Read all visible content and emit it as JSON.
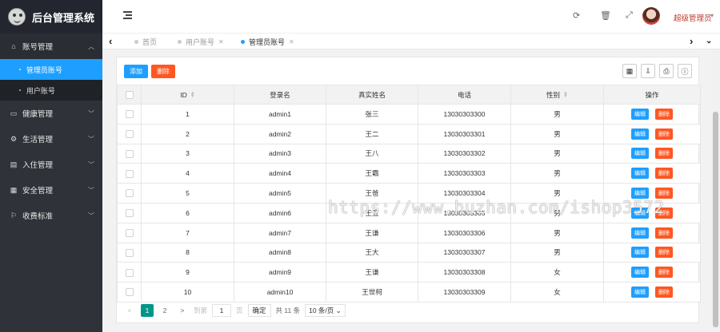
{
  "app": {
    "title": "后台管理系统"
  },
  "sidebar": {
    "groups": [
      {
        "label": "账号管理",
        "icon": "home-icon",
        "open": true,
        "children": [
          {
            "label": "管理员账号",
            "icon": "dashboard-icon",
            "active": true
          },
          {
            "label": "用户账号",
            "icon": "dashboard-icon",
            "active": false
          }
        ]
      },
      {
        "label": "健康管理",
        "icon": "card-icon"
      },
      {
        "label": "生活管理",
        "icon": "cog-icon"
      },
      {
        "label": "入住管理",
        "icon": "file-icon"
      },
      {
        "label": "安全管理",
        "icon": "calendar-icon"
      },
      {
        "label": "收费标准",
        "icon": "flag-icon"
      }
    ]
  },
  "header": {
    "user_name": "超级管理员",
    "icons": [
      "refresh-icon",
      "trash-icon",
      "fullscreen-icon"
    ]
  },
  "tabs": {
    "items": [
      {
        "label": "首页",
        "closable": false,
        "active": false
      },
      {
        "label": "用户账号",
        "closable": true,
        "active": false
      },
      {
        "label": "管理员账号",
        "closable": true,
        "active": true
      }
    ]
  },
  "toolbar": {
    "add_label": "添加",
    "delete_label": "删除"
  },
  "table": {
    "headers": {
      "id": "ID",
      "login": "登录名",
      "realname": "真实姓名",
      "phone": "电话",
      "gender": "性别",
      "actions": "操作"
    },
    "edit_label": "编辑",
    "delete_label": "删除",
    "rows": [
      {
        "id": "1",
        "login": "admin1",
        "realname": "张三",
        "phone": "13030303300",
        "gender": "男"
      },
      {
        "id": "2",
        "login": "admin2",
        "realname": "王二",
        "phone": "13030303301",
        "gender": "男"
      },
      {
        "id": "3",
        "login": "admin3",
        "realname": "王八",
        "phone": "13030303302",
        "gender": "男"
      },
      {
        "id": "4",
        "login": "admin4",
        "realname": "王霸",
        "phone": "13030303303",
        "gender": "男"
      },
      {
        "id": "5",
        "login": "admin5",
        "realname": "王爸",
        "phone": "13030303304",
        "gender": "男"
      },
      {
        "id": "6",
        "login": "admin6",
        "realname": "王五",
        "phone": "13030303305",
        "gender": "男"
      },
      {
        "id": "7",
        "login": "admin7",
        "realname": "王谦",
        "phone": "13030303306",
        "gender": "男"
      },
      {
        "id": "8",
        "login": "admin8",
        "realname": "王大",
        "phone": "13030303307",
        "gender": "男"
      },
      {
        "id": "9",
        "login": "admin9",
        "realname": "王谦",
        "phone": "13030303308",
        "gender": "女"
      },
      {
        "id": "10",
        "login": "admin10",
        "realname": "王世柯",
        "phone": "13030303309",
        "gender": "女"
      }
    ]
  },
  "pager": {
    "prev": "<",
    "pages": [
      "1",
      "2"
    ],
    "current": "1",
    "next": ">",
    "goto_label": "到第",
    "goto_value": "1",
    "page_label": "页",
    "ok_label": "确定",
    "total_label": "共 11 条",
    "page_size": "10 条/页"
  },
  "watermark": "https://www.huzhan.com/ishop3572",
  "colors": {
    "sidebar": "#2f3238",
    "active": "#1e9fff",
    "danger": "#ff5722",
    "pager_current": "#009688",
    "username": "#c0392b"
  }
}
